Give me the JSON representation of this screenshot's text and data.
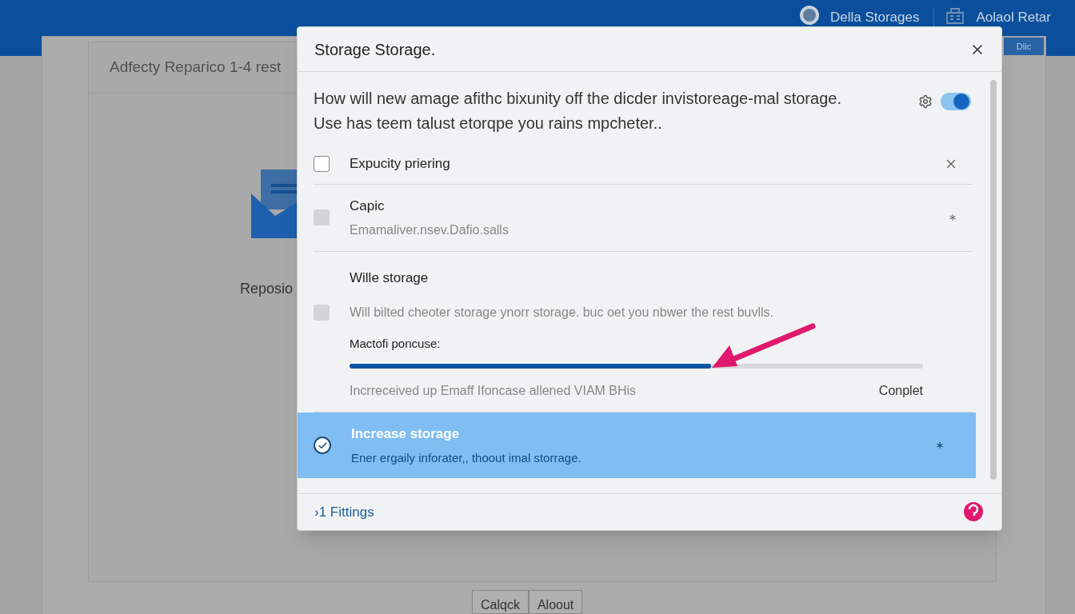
{
  "background": {
    "header": {
      "account": "Della Storages",
      "user": "Aolaol Retar",
      "badge": "Dlic"
    },
    "panel": {
      "title": "Adfecty Reparico 1-4 rest",
      "label": "Reposio"
    },
    "buttons": [
      "Calqck",
      "Aloout"
    ]
  },
  "dialog": {
    "title": "Storage Storage.",
    "intro": "How will new amage afithc bixunity off the dicder invistoreage-mal storage. Use has teem talust etorqpe you rains mpcheter..",
    "toggle": {
      "on": true
    },
    "options": [
      {
        "kind": "dismissible",
        "title": "Expucity priering",
        "checked": false,
        "disabled": false,
        "selected": false
      },
      {
        "kind": "note",
        "title": "Capic",
        "subtitle": "Emamaliver.nsev.Dafio.salls",
        "checked": false,
        "disabled": true,
        "selected": false
      },
      {
        "kind": "slider",
        "title": "Wille storage",
        "subtitle": "Will bilted cheoter storage ynorr storage. buc oet you nbwer the rest buvlls.",
        "checked": false,
        "disabled": true,
        "selected": false,
        "slider_label": "Mactofi poncuse:",
        "level": 0.63,
        "caption": "Incrreceived up Emaff Ifoncase allened VIAM BHis",
        "status": "Conplet"
      },
      {
        "kind": "note",
        "title": "Increase storage",
        "subtitle": "Ener ergaily inforater,, thoout imal storrage.",
        "checked": true,
        "disabled": false,
        "selected": true
      }
    ],
    "footer_link": "›1 Fittings"
  }
}
